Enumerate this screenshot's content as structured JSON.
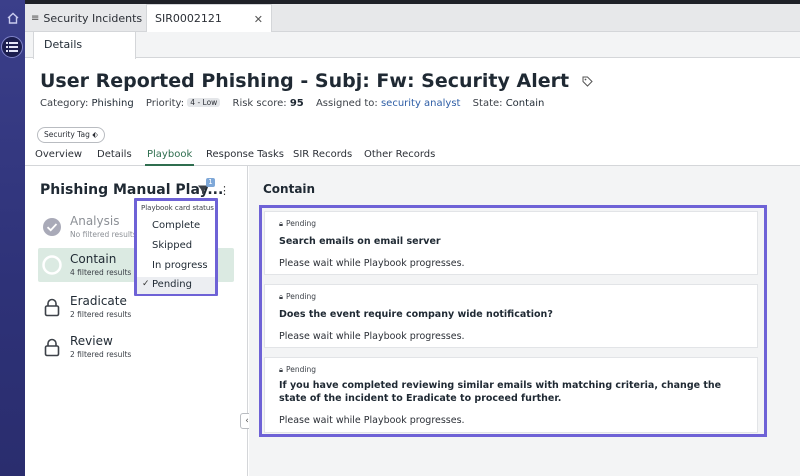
{
  "tabs": {
    "list_label": "Security Incidents",
    "record_label": "SIR0002121",
    "close_icon": "close-icon"
  },
  "subtab": {
    "label": "Details"
  },
  "header": {
    "title": "User Reported Phishing - Subj: Fw: Security Alert",
    "category_label": "Category:",
    "category_value": "Phishing",
    "priority_label": "Priority:",
    "priority_value": "4 - Low",
    "risk_label": "Risk score:",
    "risk_value": "95",
    "assigned_label": "Assigned to:",
    "assigned_value": "security analyst",
    "state_label": "State:",
    "state_value": "Contain",
    "tag_label": "Security Tag"
  },
  "record_tabs": [
    "Overview",
    "Details",
    "Playbook",
    "Response Tasks",
    "SIR Records",
    "Other Records"
  ],
  "playbook": {
    "title": "Phishing Manual Play...",
    "filter_count": "1",
    "stages": [
      {
        "name": "Analysis",
        "sub": "No filtered results"
      },
      {
        "name": "Contain",
        "sub": "4 filtered results"
      },
      {
        "name": "Eradicate",
        "sub": "2 filtered results"
      },
      {
        "name": "Review",
        "sub": "2 filtered results"
      }
    ]
  },
  "dropdown": {
    "header": "Playbook card status",
    "items": [
      "Complete",
      "Skipped",
      "In progress",
      "Pending"
    ],
    "checked": "Pending"
  },
  "contain": {
    "heading": "Contain",
    "cards": [
      {
        "status": "Pending",
        "title": "Search emails on email server",
        "wait": "Please wait while Playbook progresses."
      },
      {
        "status": "Pending",
        "title": "Does the event require company wide notification?",
        "wait": "Please wait while Playbook progresses."
      },
      {
        "status": "Pending",
        "title": "If you have completed reviewing similar emails with matching criteria, change the state of the incident to Eradicate to proceed further.",
        "wait": "Please wait while Playbook progresses."
      }
    ]
  },
  "colors": {
    "accent": "#2f6e4f",
    "highlight_border": "#6e62d6",
    "rail": "#2e3278"
  }
}
